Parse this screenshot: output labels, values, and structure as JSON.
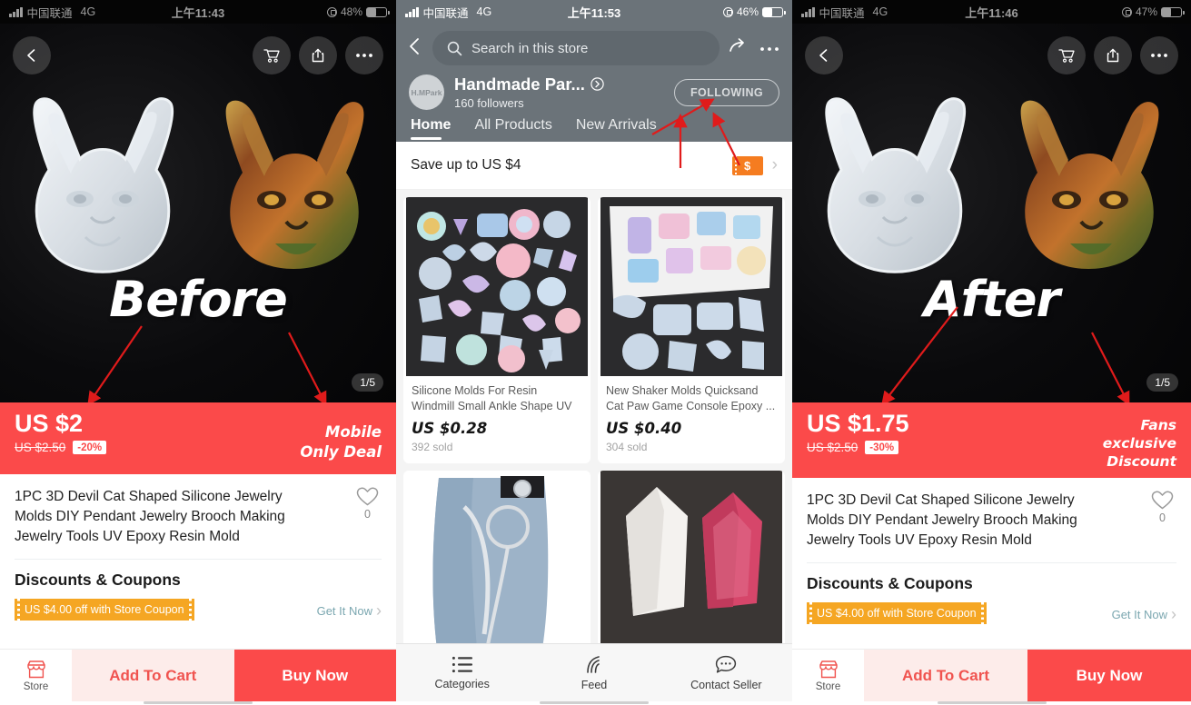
{
  "panels": {
    "left": {
      "status": {
        "carrier": "中国联通",
        "network": "4G",
        "time": "上午11:43",
        "battery": "48%"
      },
      "photo": {
        "overlay_word": "Before",
        "pager": "1/5"
      },
      "price": {
        "current": "US $2",
        "original": "US $2.50",
        "discount": "-20%",
        "badge_line1": "Mobile",
        "badge_line2": "Only Deal"
      },
      "product": {
        "title": "1PC 3D Devil Cat Shaped Silicone Jewelry Molds DIY Pendant Jewelry Brooch Making Jewelry Tools UV Epoxy Resin Mold",
        "fav_count": "0"
      },
      "coupons": {
        "heading": "Discounts & Coupons",
        "ticket": "US $4.00 off with Store Coupon",
        "cta": "Get It Now"
      },
      "actions": {
        "store": "Store",
        "add_to_cart": "Add To Cart",
        "buy_now": "Buy Now"
      }
    },
    "middle": {
      "status": {
        "carrier": "中国联通",
        "network": "4G",
        "time": "上午11:53",
        "battery": "46%"
      },
      "search_placeholder": "Search in this store",
      "store": {
        "avatar_text": "H.MPark",
        "name": "Handmade Par...",
        "followers": "160  followers",
        "follow_button": "FOLLOWING"
      },
      "tabs": [
        {
          "label": "Home",
          "active": true
        },
        {
          "label": "All Products",
          "active": false
        },
        {
          "label": "New Arrivals",
          "active": false
        }
      ],
      "save_banner": {
        "label": "Save up to US $4",
        "icon": "$"
      },
      "products": [
        {
          "name": "Silicone Molds For Resin Windmill Small Ankle Shape UV ...",
          "price": "US $0.28",
          "sold": "392 sold"
        },
        {
          "name": "New Shaker Molds Quicksand Cat Paw Game Console Epoxy ...",
          "price": "US $0.40",
          "sold": "304 sold"
        },
        {
          "name": "",
          "price": "",
          "sold": ""
        },
        {
          "name": "",
          "price": "",
          "sold": ""
        }
      ],
      "bottom_nav": [
        {
          "label": "Categories",
          "icon": "list-icon"
        },
        {
          "label": "Feed",
          "icon": "rss-icon"
        },
        {
          "label": "Contact Seller",
          "icon": "chat-icon"
        }
      ]
    },
    "right": {
      "status": {
        "carrier": "中国联通",
        "network": "4G",
        "time": "上午11:46",
        "battery": "47%"
      },
      "photo": {
        "overlay_word": "After",
        "pager": "1/5"
      },
      "price": {
        "current": "US $1.75",
        "original": "US $2.50",
        "discount": "-30%",
        "badge_line1": "Fans",
        "badge_line2": "exclusive",
        "badge_line3": "Discount"
      },
      "product": {
        "title": "1PC 3D Devil Cat Shaped Silicone Jewelry Molds DIY Pendant Jewelry Brooch Making Jewelry Tools UV Epoxy Resin Mold",
        "fav_count": "0"
      },
      "coupons": {
        "heading": "Discounts & Coupons",
        "ticket": "US $4.00 off with Store Coupon",
        "cta": "Get It Now"
      },
      "actions": {
        "store": "Store",
        "add_to_cart": "Add To Cart",
        "buy_now": "Buy Now"
      }
    }
  },
  "colors": {
    "price_red": "#fb4a4a",
    "coupon_orange": "#f5a623",
    "store_header_gray": "#6b7379",
    "annotation_red": "#e01b1b",
    "cta_teal": "#7ba7b0"
  }
}
